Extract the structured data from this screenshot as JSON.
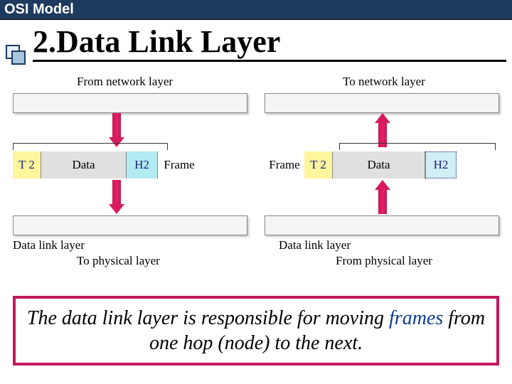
{
  "header": {
    "title": "OSI Model"
  },
  "page_title": "2.Data Link Layer",
  "left": {
    "top_label": "From network layer",
    "layer_label": "Data link layer",
    "bottom_label": "To physical layer",
    "frame": {
      "t2": "T 2",
      "data": "Data",
      "h2": "H2",
      "frame_label": "Frame"
    }
  },
  "right": {
    "top_label": "To network layer",
    "layer_label": "Data link layer",
    "bottom_label": "From physical layer",
    "frame": {
      "frame_label": "Frame",
      "t2": "T 2",
      "data": "Data",
      "h2": "H2"
    }
  },
  "caption": {
    "pre": "The data link layer is responsible for moving ",
    "keyword": "frames",
    "post": " from one hop (node) to the next."
  }
}
